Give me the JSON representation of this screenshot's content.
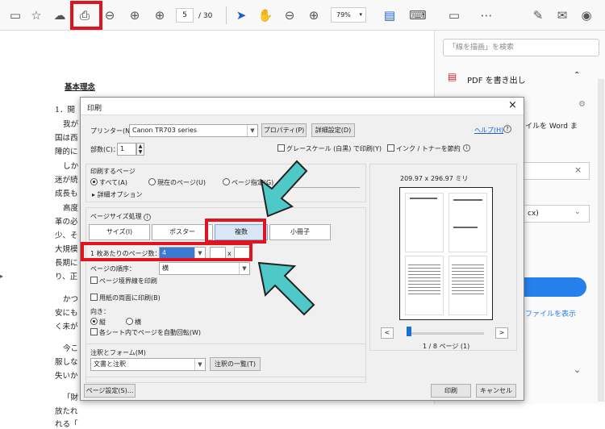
{
  "toolbar": {
    "current_page": "5",
    "page_total": "/ 30",
    "zoom": "79%"
  },
  "document": {
    "heading": "基本理念",
    "lines": [
      "1．開",
      "我が",
      "国は西",
      "障的に",
      "しか",
      "迷が続",
      "成長も",
      "高度",
      "革の必",
      "少、そ",
      "大規模",
      "長期に",
      "り、正",
      "かつ",
      "安にも",
      "く未が",
      "今こ",
      "服しな",
      "失いか",
      "「財",
      "放たれ",
      "れる「"
    ]
  },
  "right_panel": {
    "search_placeholder": "「線を描画」を検索",
    "export_label": "PDF を書き出し",
    "convert_text": "イルを Word ま",
    "partial_text": "cx)",
    "show_files": "ファイルを表示"
  },
  "dialog": {
    "title": "印刷",
    "printer_label": "プリンター(N)：",
    "printer_value": "Canon TR703 series",
    "properties_button": "プロパティ(P)",
    "advanced_button": "詳細設定(D)",
    "help_link": "ヘルプ(H)",
    "copies_label": "部数(C)：",
    "copies_value": "1",
    "grayscale_label": "グレースケール (白黒) で印刷(Y)",
    "ink_label": "インク / トナーを節約",
    "pages_section": "印刷するページ",
    "all_label": "すべて(A)",
    "current_label": "現在のページ(U)",
    "specified_label": "ページ指定(G)",
    "more_options": "詳細オプション",
    "size_section": "ページサイズ処理",
    "size_button": "サイズ(I)",
    "poster_button": "ポスター",
    "multiple_button": "複数",
    "booklet_button": "小冊子",
    "pages_per_sheet_label": "1 枚あたりのページ数：",
    "pages_per_sheet_value": "4",
    "grid_x": "x",
    "page_order_label": "ページの順序：",
    "page_order_value": "横",
    "border_label": "ページ境界線を印刷",
    "duplex_label": "用紙の両面に印刷(B)",
    "orientation_label": "向き：",
    "portrait_label": "縦",
    "landscape_label": "横",
    "autorotate_label": "各シート内でページを自動回転(W)",
    "annotations_section": "注釈とフォーム(M)",
    "annotations_value": "文書と注釈",
    "annotations_button": "注釈の一覧(T)",
    "paper_size": "209.97 x 296.97 ミリ",
    "page_indicator": "1 / 8 ページ (1)",
    "page_setup_button": "ページ設定(S)...",
    "print_button": "印刷",
    "cancel_button": "キャンセル"
  }
}
